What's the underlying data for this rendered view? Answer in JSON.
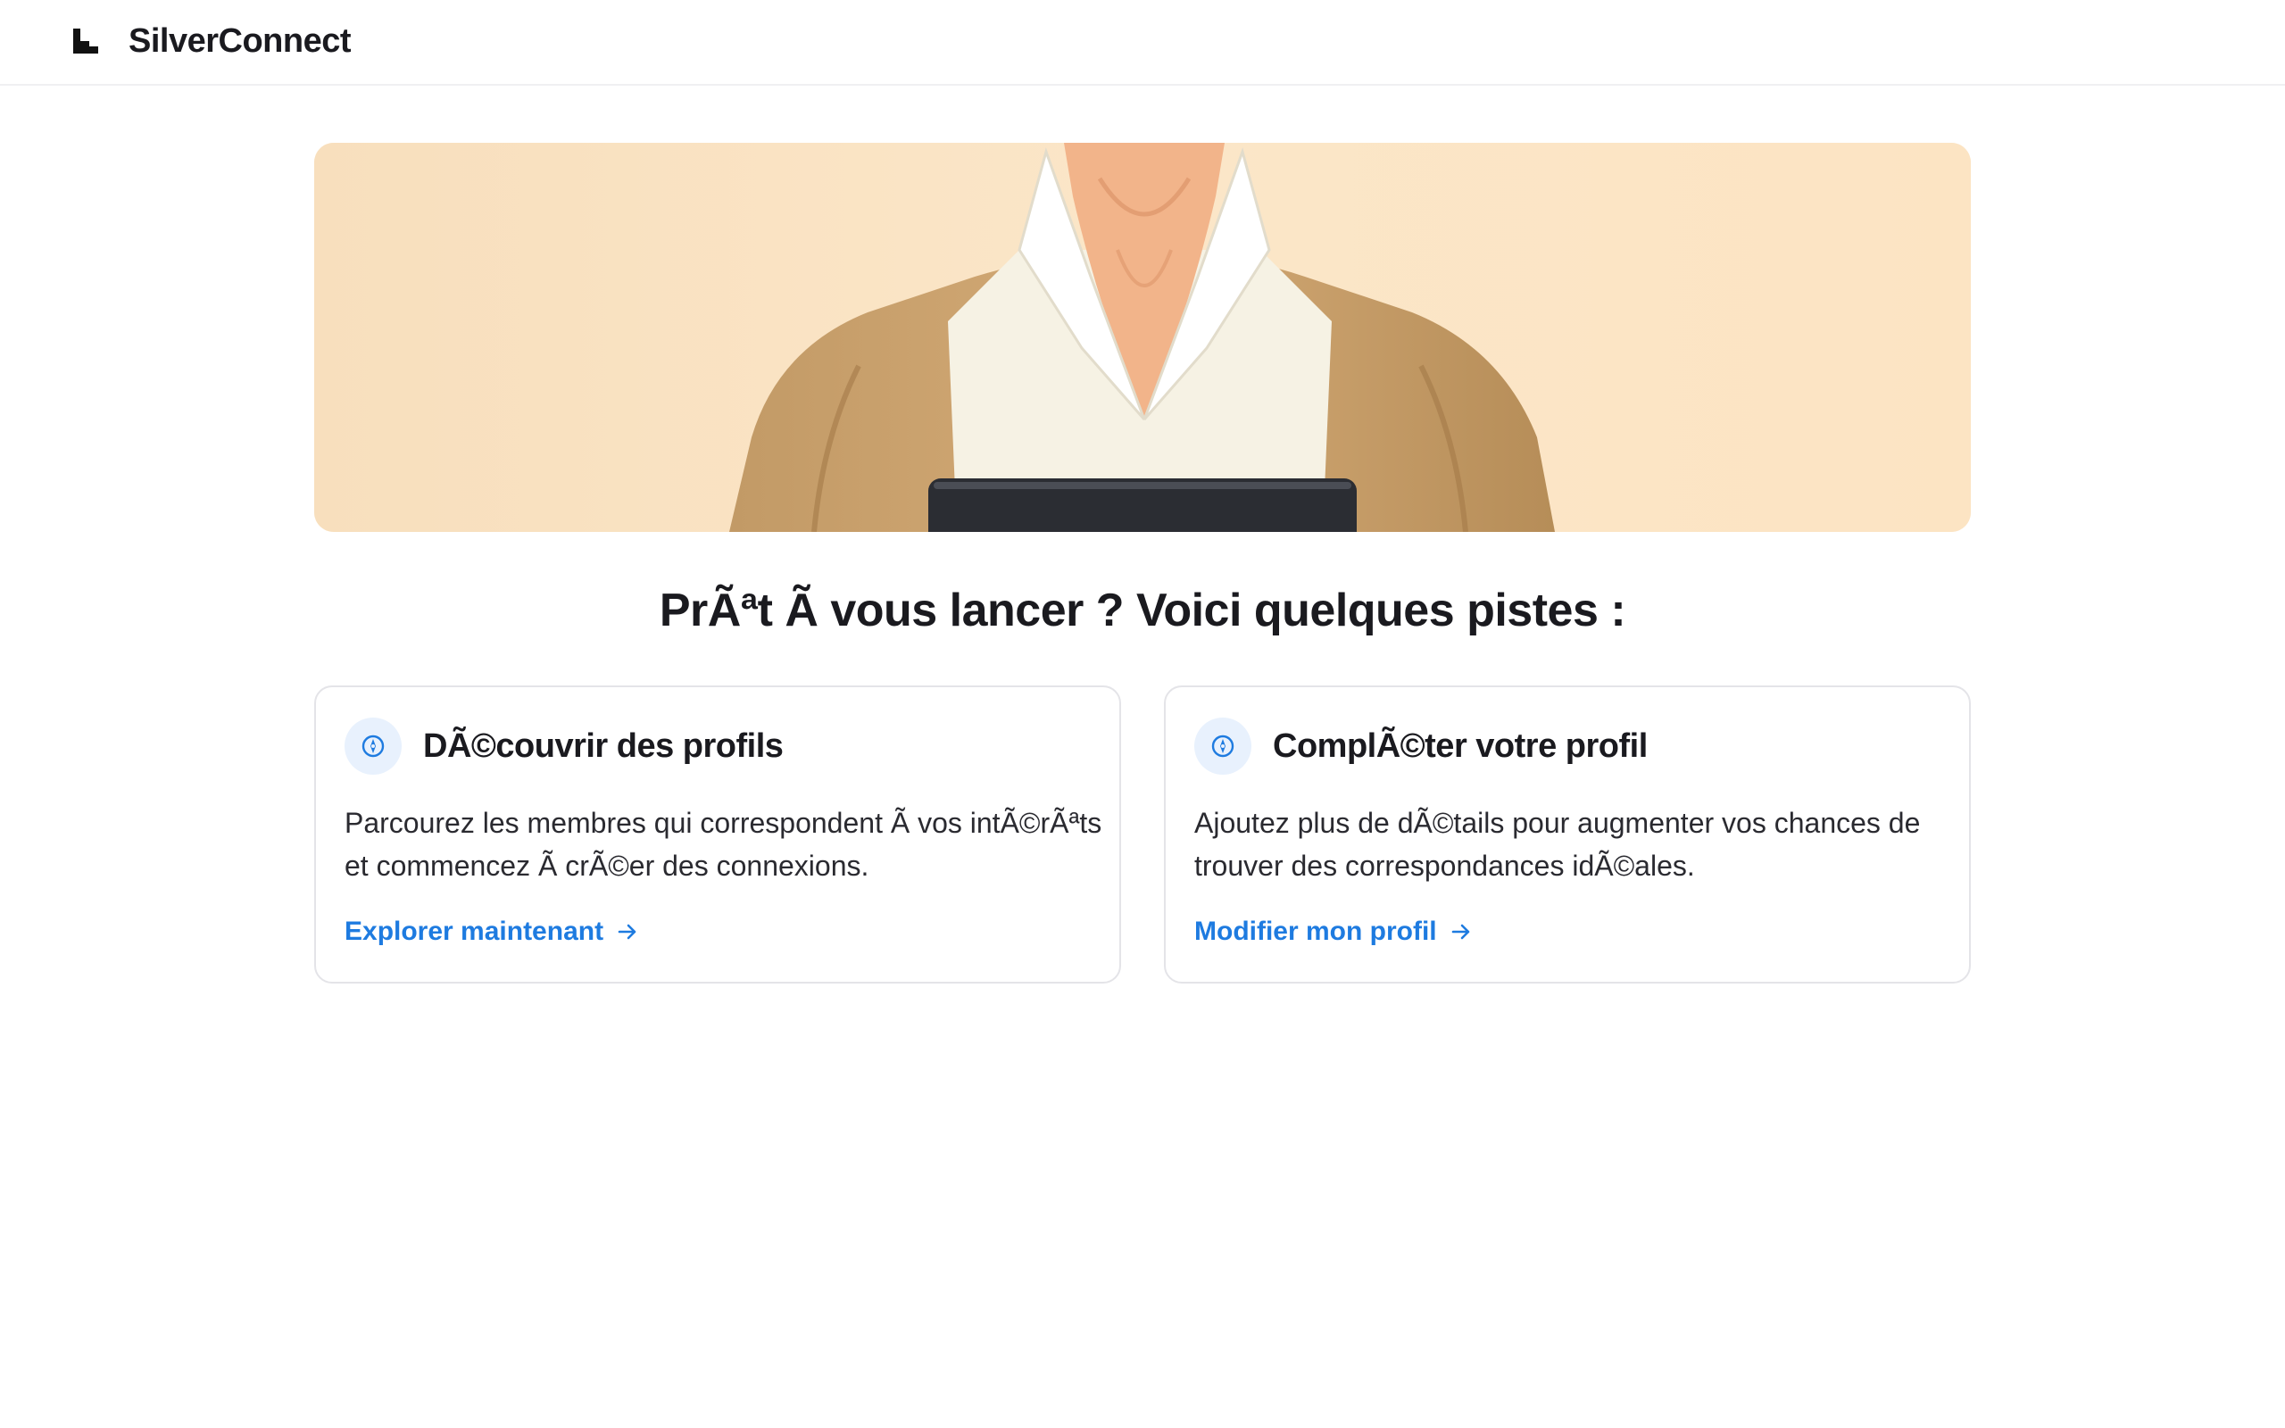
{
  "app": {
    "brand": "SilverConnect",
    "logo_icon": "chart-bars-icon"
  },
  "hero": {
    "image": "illustrated-senior-person-holding-tablet",
    "background": "#fbe4c4"
  },
  "main": {
    "headline": "PrÃªt Ã  vous lancer ? Voici quelques pistes :",
    "cards": [
      {
        "icon": "compass-icon",
        "title": "DÃ©couvrir des profils",
        "description": "Parcourez les membres qui correspondent Ã  vos intÃ©rÃªts et commencez Ã  crÃ©er des connexions.",
        "link_label": "Explorer maintenant",
        "link_icon": "arrow-right-icon"
      },
      {
        "icon": "compass-icon",
        "title": "ComplÃ©ter votre profil",
        "description": "Ajoutez plus de dÃ©tails pour augmenter vos chances de trouver des correspondances idÃ©ales.",
        "link_label": "Modifier mon profil",
        "link_icon": "arrow-right-icon"
      }
    ]
  },
  "colors": {
    "accent": "#1e7be0",
    "icon_bg": "#e8f1fd",
    "text": "#1a1a1f",
    "border": "#e4e4e8"
  }
}
